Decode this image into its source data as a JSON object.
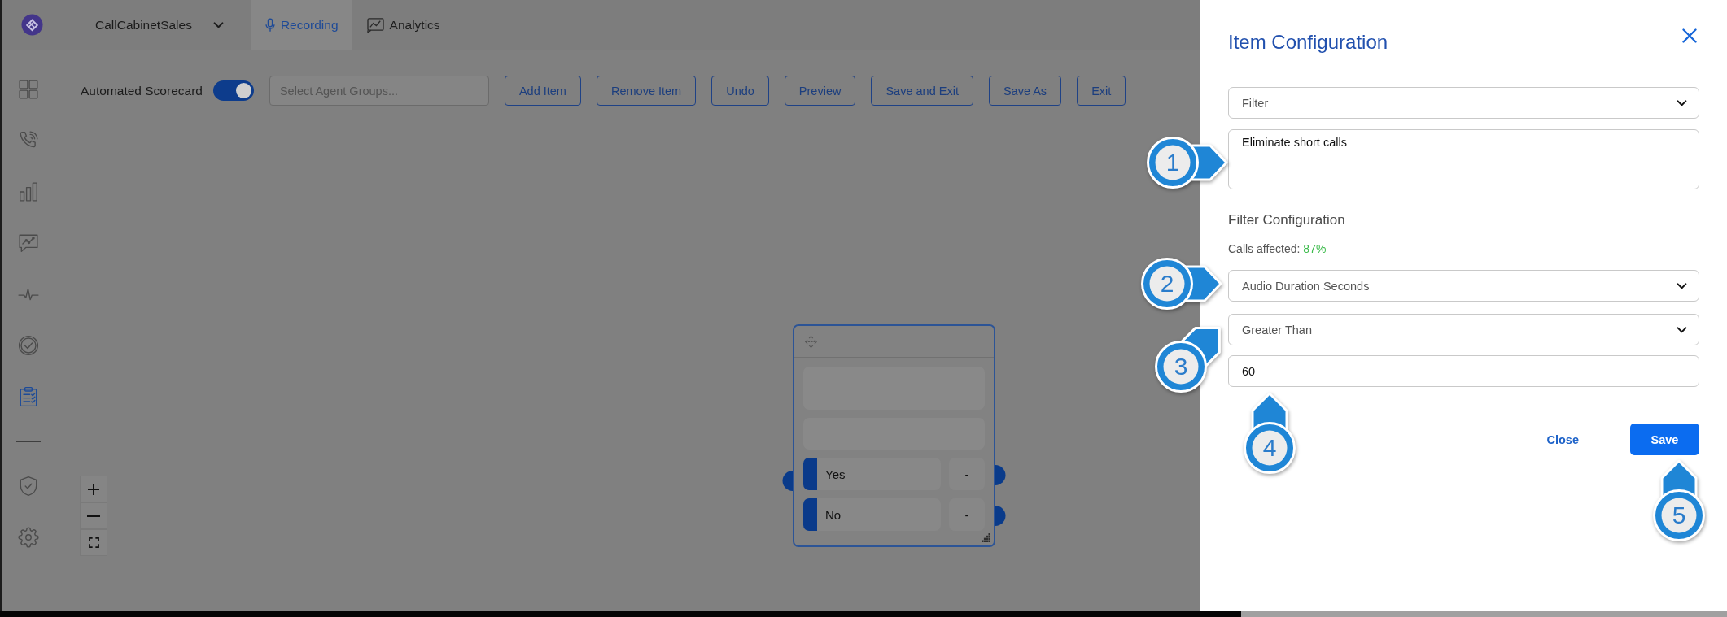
{
  "app_header": {
    "workspace": "CallCabinetSales",
    "tabs": [
      {
        "label": "Recording",
        "selected": true
      },
      {
        "label": "Analytics",
        "selected": false
      }
    ]
  },
  "sidebar": {
    "items": [
      {
        "selected": false
      },
      {
        "selected": false
      },
      {
        "selected": false
      },
      {
        "selected": false
      },
      {
        "selected": false
      },
      {
        "selected": false
      },
      {
        "selected": true
      },
      {
        "selected": false
      },
      {
        "selected": false
      }
    ]
  },
  "toolbar": {
    "toggle": {
      "label": "Automated Scorecard",
      "on": true
    },
    "agent_groups": {
      "placeholder": "Select Agent Groups..."
    },
    "buttons": [
      "Add Item",
      "Remove Item",
      "Undo",
      "Preview",
      "Save and Exit",
      "Save As",
      "Exit"
    ]
  },
  "canvas": {
    "node": {
      "options": [
        {
          "label": "Yes",
          "score": "-"
        },
        {
          "label": "No",
          "score": "-"
        }
      ]
    }
  },
  "panel": {
    "title": "Item Configuration",
    "item_type": {
      "value": "Filter"
    },
    "description": {
      "value": "Eliminate short calls"
    },
    "section_title": "Filter Configuration",
    "calls_affected": {
      "label": "Calls affected:",
      "value": "87%"
    },
    "filter_field": {
      "value": "Audio Duration Seconds"
    },
    "operator": {
      "value": "Greater Than"
    },
    "threshold": {
      "value": "60"
    },
    "actions": [
      {
        "label": "Close",
        "kind": "link"
      },
      {
        "label": "Save",
        "kind": "primary"
      }
    ]
  },
  "callouts": [
    {
      "label": "1"
    },
    {
      "label": "2"
    },
    {
      "label": "3"
    },
    {
      "label": "4"
    },
    {
      "label": "5"
    }
  ]
}
